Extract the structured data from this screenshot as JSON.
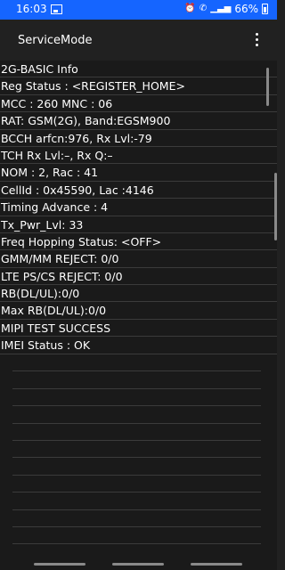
{
  "status_bar": {
    "time": "16:03",
    "battery_text": "66%"
  },
  "app_bar": {
    "title": "ServiceMode"
  },
  "info_lines": [
    "2G-BASIC Info",
    "Reg Status : <REGISTER_HOME>",
    "MCC : 260 MNC : 06",
    "RAT: GSM(2G), Band:EGSM900",
    "BCCH arfcn:976, Rx Lvl:-79",
    "TCH Rx Lvl:–, Rx Q:–",
    "NOM : 2, Rac : 41",
    "CellId : 0x45590, Lac :4146",
    "Timing Advance : 4",
    "Tx_Pwr_Lvl: 33",
    "Freq Hopping Status: <OFF>",
    "GMM/MM REJECT: 0/0",
    "LTE PS/CS REJECT: 0/0",
    "RB(DL/UL):0/0",
    "Max RB(DL/UL):0/0",
    "MIPI TEST SUCCESS",
    "IMEI Status : OK"
  ],
  "colors": {
    "status_bar": "#1565ff",
    "background": "#1a1a1a",
    "text": "#ffffff"
  }
}
